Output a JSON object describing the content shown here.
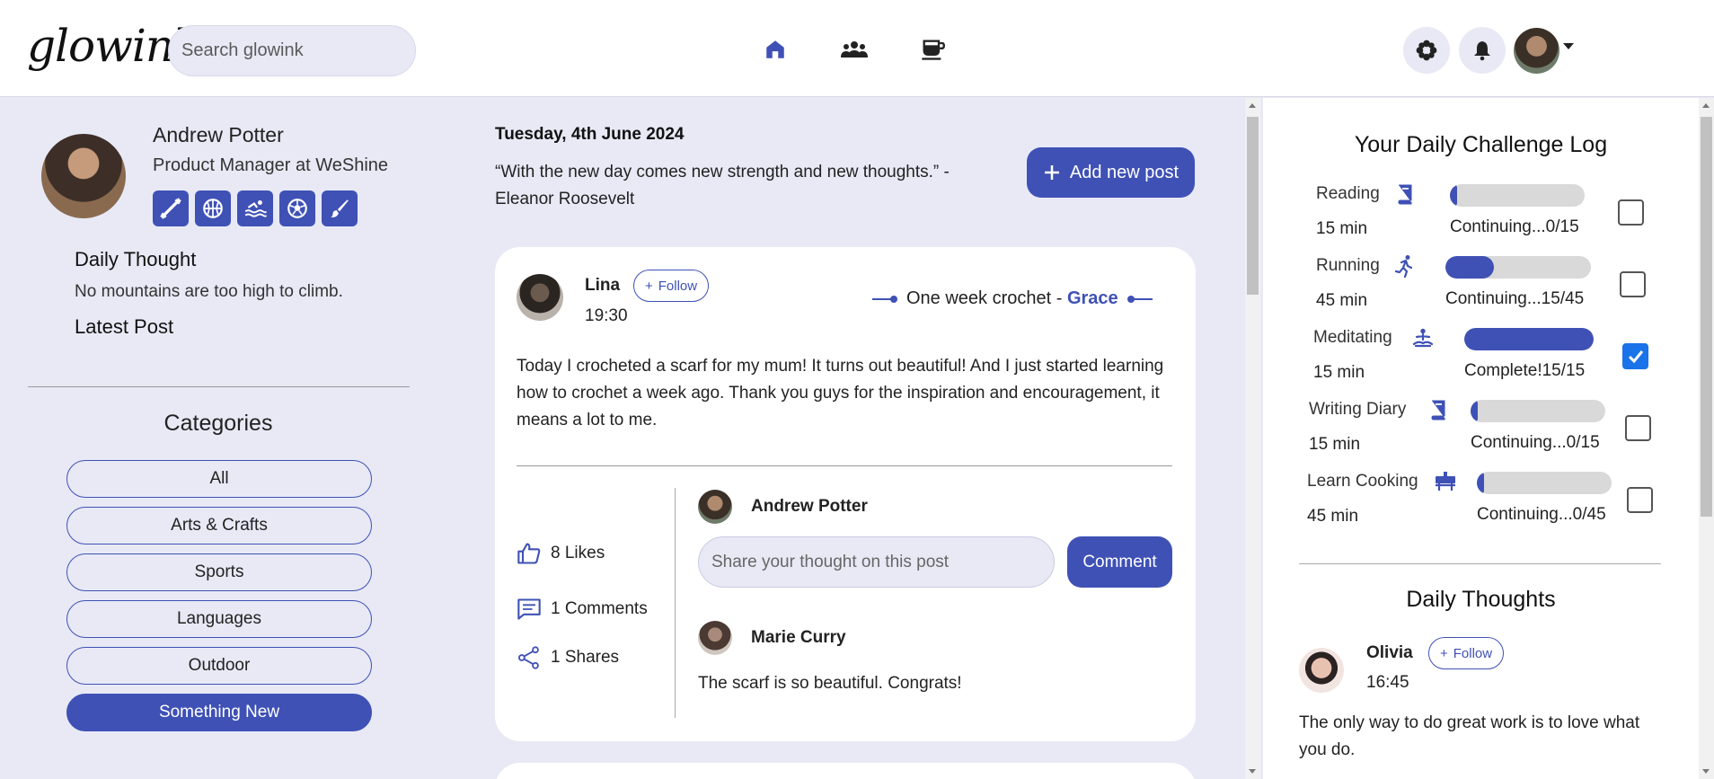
{
  "app": {
    "logo": "glowink"
  },
  "search": {
    "placeholder": "Search glowink"
  },
  "nav": {
    "home_icon": "home-icon",
    "groups_icon": "groups-icon",
    "cafe_icon": "coffee-cup-icon"
  },
  "profile": {
    "name": "Andrew Potter",
    "role": "Product Manager at WeShine",
    "hobbies": [
      "dumbbell-icon",
      "basketball-icon",
      "swimming-icon",
      "soccer-ball-icon",
      "paintbrush-icon"
    ],
    "daily_thought_label": "Daily Thought",
    "daily_thought": "No mountains are too high to climb.",
    "latest_post_label": "Latest Post"
  },
  "categories": {
    "title": "Categories",
    "items": [
      "All",
      "Arts & Crafts",
      "Sports",
      "Languages",
      "Outdoor",
      "Something New"
    ],
    "active": "Something New"
  },
  "feed": {
    "date": "Tuesday, 4th June 2024",
    "quote": "“With the new day comes new strength and new thoughts.” - Eleanor Roosevelt",
    "add_post_label": "Add new post",
    "post": {
      "author": "Lina",
      "follow_label": "Follow",
      "time": "19:30",
      "challenge_prefix": "One week crochet - ",
      "challenge_owner": "Grace",
      "text": "Today I crocheted a scarf for my mum! It turns out beautiful! And I just started learning how to crochet a week ago. Thank you guys for the inspiration and encouragement, it means a lot to me.",
      "likes": "8 Likes",
      "comments": "1 Comments",
      "shares": "1 Shares",
      "current_user": "Andrew Potter",
      "comment_placeholder": "Share your thought on this post",
      "comment_button": "Comment",
      "comment_author": "Marie Curry",
      "comment_text": "The scarf is so beautiful. Congrats!"
    }
  },
  "challenge_log": {
    "title": "Your Daily Challenge Log",
    "items": [
      {
        "name": "Reading",
        "duration": "15 min",
        "status": "Continuing...0/15",
        "progress": 0,
        "checked": false,
        "icon": "book-icon"
      },
      {
        "name": "Running",
        "duration": "45 min",
        "status": "Continuing...15/45",
        "progress": 0.3333,
        "checked": false,
        "icon": "running-icon"
      },
      {
        "name": "Meditating",
        "duration": "15 min",
        "status": "Complete!15/15",
        "progress": 1,
        "checked": true,
        "icon": "meditation-icon"
      },
      {
        "name": "Writing Diary",
        "duration": "15 min",
        "status": "Continuing...0/15",
        "progress": 0,
        "checked": false,
        "icon": "book-icon"
      },
      {
        "name": "Learn Cooking",
        "duration": "45 min",
        "status": "Continuing...0/45",
        "progress": 0,
        "checked": false,
        "icon": "cooking-icon"
      }
    ]
  },
  "daily_thoughts": {
    "title": "Daily Thoughts",
    "author": "Olivia",
    "follow_label": "Follow",
    "time": "16:45",
    "text": "The only way to do great work is to love what you do."
  },
  "colors": {
    "accent": "#3f51b5",
    "background": "#e8e9f5",
    "checkbox": "#1a73e8"
  }
}
